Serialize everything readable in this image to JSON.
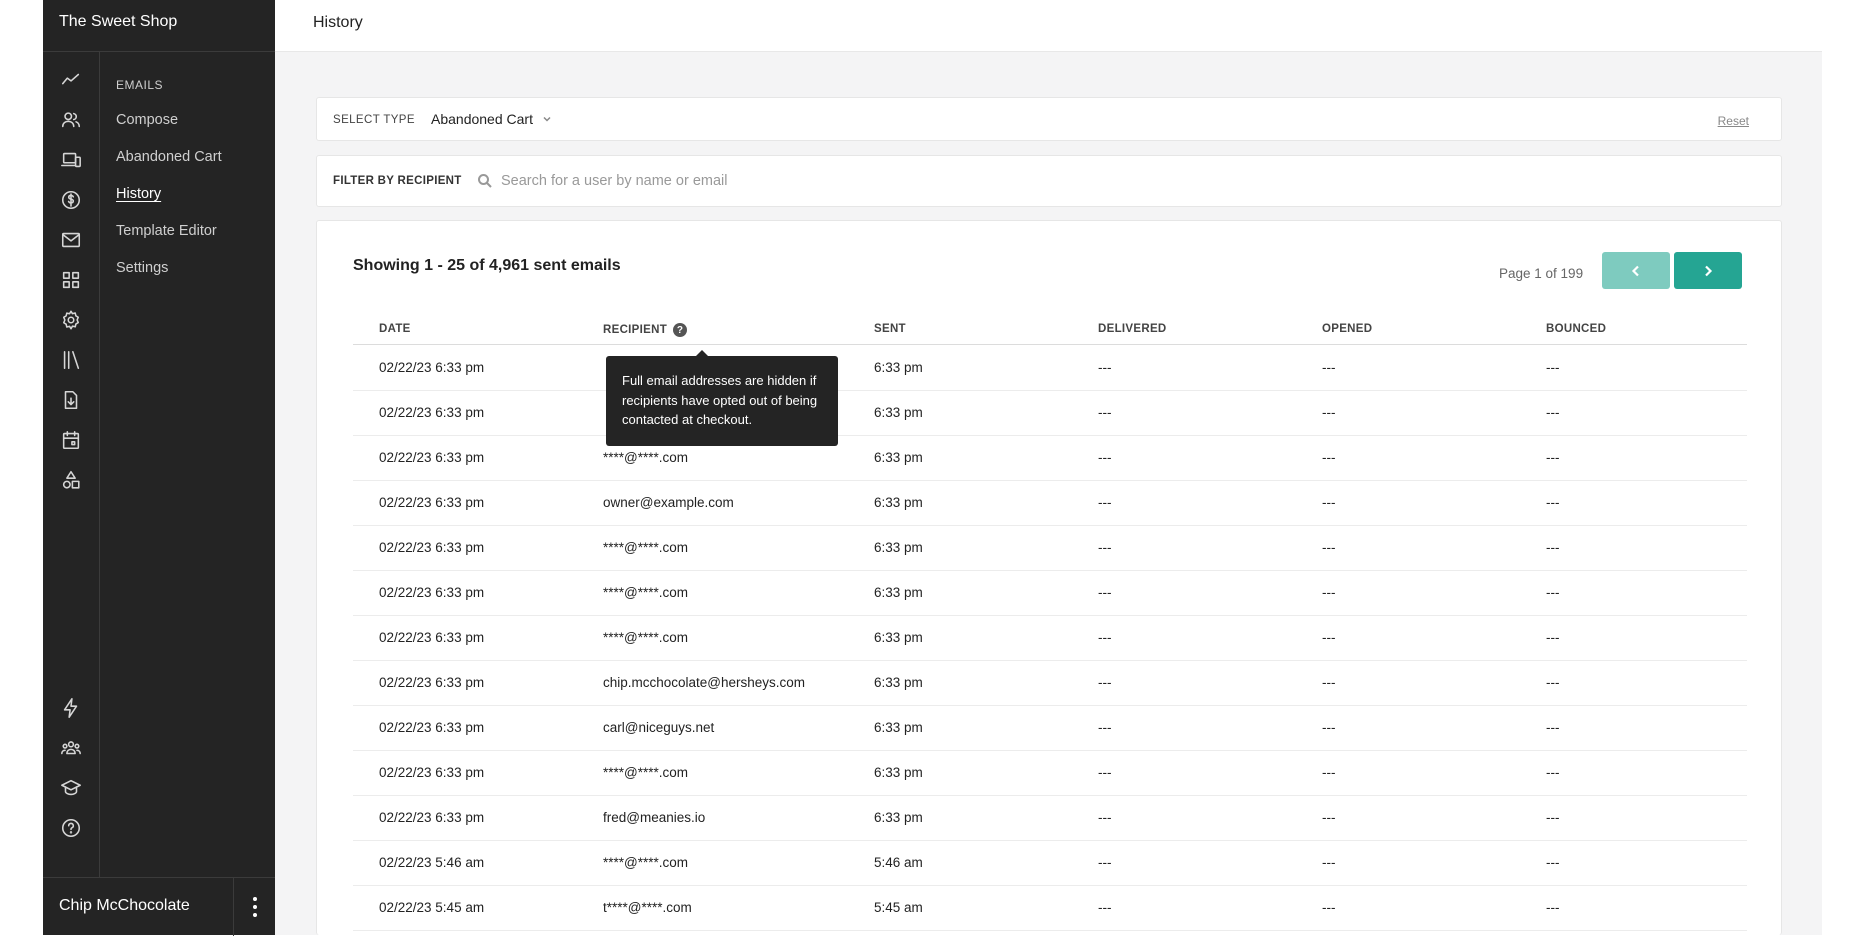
{
  "sidebar": {
    "shop_name": "The Sweet Shop",
    "rail_icons": [
      "analytics-icon",
      "customers-icon",
      "devices-icon",
      "dollar-icon",
      "mail-icon",
      "apps-grid-icon",
      "gear-icon",
      "library-icon",
      "download-doc-icon",
      "calendar-icon",
      "shapes-icon",
      "lightning-icon",
      "team-icon",
      "graduation-cap-icon",
      "help-circle-icon"
    ],
    "section_header": "EMAILS",
    "items": [
      {
        "label": "Compose",
        "active": false
      },
      {
        "label": "Abandoned Cart",
        "active": false
      },
      {
        "label": "History",
        "active": true
      },
      {
        "label": "Template Editor",
        "active": false
      },
      {
        "label": "Settings",
        "active": false
      }
    ],
    "user_name": "Chip McChocolate"
  },
  "header": {
    "title": "History"
  },
  "type_filter": {
    "label": "SELECT TYPE",
    "selected": "Abandoned Cart",
    "reset_label": "Reset"
  },
  "recipient_filter": {
    "label": "FILTER BY RECIPIENT",
    "placeholder": "Search for a user by name or email",
    "value": ""
  },
  "table": {
    "showing": "Showing 1 - 25 of 4,961 sent emails",
    "page_info": "Page 1 of 199",
    "columns": [
      "DATE",
      "RECIPIENT",
      "SENT",
      "DELIVERED",
      "OPENED",
      "BOUNCED"
    ],
    "tooltip": "Full email addresses are hidden if recipients have opted out of being contacted at checkout.",
    "rows": [
      [
        "02/22/23 6:33 pm",
        "",
        "6:33 pm",
        "---",
        "---",
        "---"
      ],
      [
        "02/22/23 6:33 pm",
        "",
        "6:33 pm",
        "---",
        "---",
        "---"
      ],
      [
        "02/22/23 6:33 pm",
        "****@****.com",
        "6:33 pm",
        "---",
        "---",
        "---"
      ],
      [
        "02/22/23 6:33 pm",
        "owner@example.com",
        "6:33 pm",
        "---",
        "---",
        "---"
      ],
      [
        "02/22/23 6:33 pm",
        "****@****.com",
        "6:33 pm",
        "---",
        "---",
        "---"
      ],
      [
        "02/22/23 6:33 pm",
        "****@****.com",
        "6:33 pm",
        "---",
        "---",
        "---"
      ],
      [
        "02/22/23 6:33 pm",
        "****@****.com",
        "6:33 pm",
        "---",
        "---",
        "---"
      ],
      [
        "02/22/23 6:33 pm",
        "chip.mcchocolate@hersheys.com",
        "6:33 pm",
        "---",
        "---",
        "---"
      ],
      [
        "02/22/23 6:33 pm",
        "carl@niceguys.net",
        "6:33 pm",
        "---",
        "---",
        "---"
      ],
      [
        "02/22/23 6:33 pm",
        "****@****.com",
        "6:33 pm",
        "---",
        "---",
        "---"
      ],
      [
        "02/22/23 6:33 pm",
        "fred@meanies.io",
        "6:33 pm",
        "---",
        "---",
        "---"
      ],
      [
        "02/22/23 5:46 am",
        "****@****.com",
        "5:46 am",
        "---",
        "---",
        "---"
      ],
      [
        "02/22/23 5:45 am",
        "t****@****.com",
        "5:45 am",
        "---",
        "---",
        "---"
      ]
    ]
  },
  "colors": {
    "sidebar_bg": "#242424",
    "accent": "#25a593",
    "accent_disabled": "#7ecbbf"
  }
}
